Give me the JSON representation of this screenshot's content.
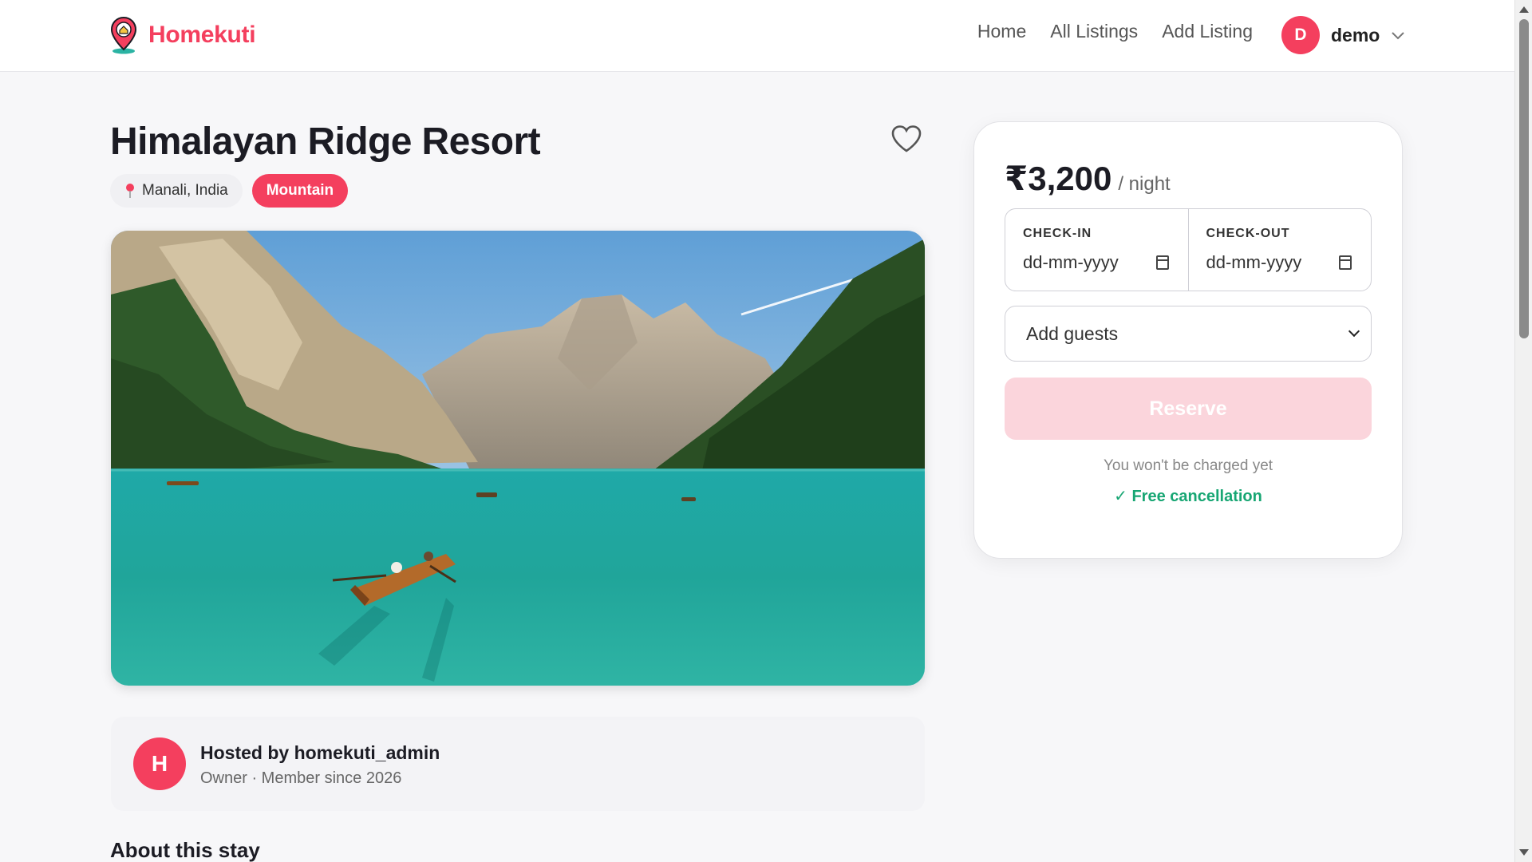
{
  "app": {
    "name": "Homekuti"
  },
  "nav": {
    "items": [
      "Home",
      "All Listings",
      "Add Listing"
    ]
  },
  "user": {
    "initial": "D",
    "name": "demo"
  },
  "listing": {
    "title": "Himalayan Ridge Resort",
    "location": "Manali, India",
    "category": "Mountain"
  },
  "host": {
    "initial": "H",
    "name": "Hosted by homekuti_admin",
    "meta": "Owner · Member since 2026"
  },
  "about": {
    "heading": "About this stay"
  },
  "booking": {
    "price": "₹3,200",
    "unit": "/ night",
    "checkin_label": "CHECK-IN",
    "checkin_value": "dd-mm-yyyy",
    "checkout_label": "CHECK-OUT",
    "checkout_value": "dd-mm-yyyy",
    "guests_placeholder": "Add guests",
    "reserve_label": "Reserve",
    "note": "You won't be charged yet",
    "free_cancellation": "✓ Free cancellation"
  },
  "colors": {
    "brand": "#f43f5e",
    "success": "#17a673"
  }
}
